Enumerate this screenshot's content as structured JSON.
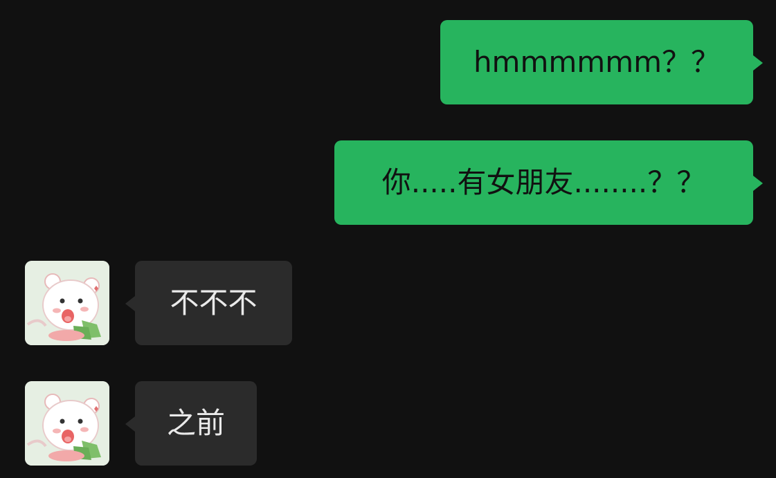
{
  "chat": {
    "messages": [
      {
        "direction": "outgoing",
        "text": "hmmmmmm？？"
      },
      {
        "direction": "outgoing",
        "text": "你.....有女朋友........？？"
      },
      {
        "direction": "incoming",
        "text": "不不不"
      },
      {
        "direction": "incoming",
        "text": "之前"
      }
    ]
  },
  "colors": {
    "background": "#111111",
    "outgoing_bubble": "#27b45e",
    "incoming_bubble": "#2b2b2b",
    "incoming_text": "#eaeaea"
  },
  "icons": {
    "contact_avatar": "cartoon-bear-avatar-icon"
  }
}
